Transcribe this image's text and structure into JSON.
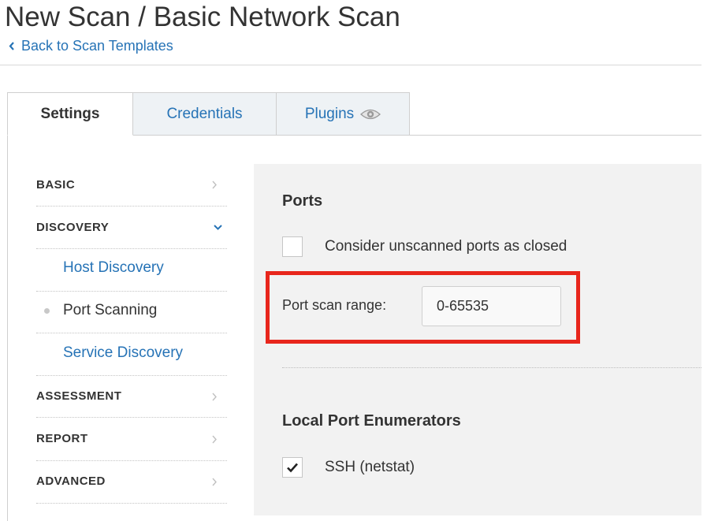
{
  "header": {
    "title": "New Scan / Basic Network Scan",
    "back_link": "Back to Scan Templates"
  },
  "tabs": [
    {
      "label": "Settings",
      "active": true
    },
    {
      "label": "Credentials",
      "active": false
    },
    {
      "label": "Plugins",
      "active": false,
      "icon": "eye-icon"
    }
  ],
  "sidebar": {
    "items": [
      {
        "label": "BASIC",
        "type": "section",
        "icon": "chevron-right-icon"
      },
      {
        "label": "DISCOVERY",
        "type": "section",
        "expanded": true,
        "icon": "chevron-down-icon"
      },
      {
        "label": "Host Discovery",
        "type": "subitem"
      },
      {
        "label": "Port Scanning",
        "type": "subitem",
        "active": true
      },
      {
        "label": "Service Discovery",
        "type": "subitem"
      },
      {
        "label": "ASSESSMENT",
        "type": "section",
        "icon": "chevron-right-icon"
      },
      {
        "label": "REPORT",
        "type": "section",
        "icon": "chevron-right-icon"
      },
      {
        "label": "ADVANCED",
        "type": "section",
        "icon": "chevron-right-icon"
      }
    ]
  },
  "content": {
    "ports": {
      "title": "Ports",
      "consider_unscanned": {
        "label": "Consider unscanned ports as closed",
        "checked": false
      },
      "port_range": {
        "label": "Port scan range:",
        "value": "0-65535"
      }
    },
    "local_enumerators": {
      "title": "Local Port Enumerators",
      "ssh": {
        "label": "SSH (netstat)",
        "checked": true
      }
    }
  },
  "colors": {
    "link": "#2673b6",
    "highlight": "#e8261c",
    "content_bg": "#f2f2f2",
    "inactive_tab_bg": "#eef2f5"
  }
}
